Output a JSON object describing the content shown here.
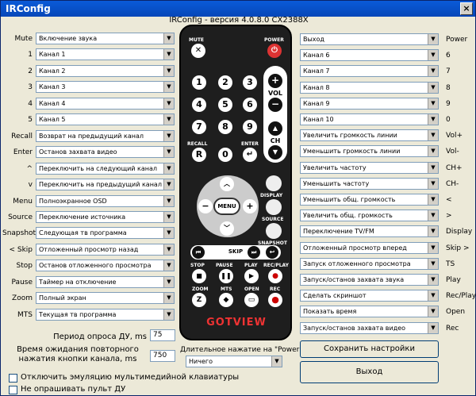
{
  "window": {
    "title": "IRConfig",
    "subtitle": "IRConfig - версия 4.0.8.0  CX2388X",
    "close": "×"
  },
  "left_rows": [
    {
      "label": "Mute",
      "value": "Включение звука"
    },
    {
      "label": "1",
      "value": "Канал 1"
    },
    {
      "label": "2",
      "value": "Канал 2"
    },
    {
      "label": "3",
      "value": "Канал 3"
    },
    {
      "label": "4",
      "value": "Канал 4"
    },
    {
      "label": "5",
      "value": "Канал 5"
    },
    {
      "label": "Recall",
      "value": "Возврат на предыдущий канал"
    },
    {
      "label": "Enter",
      "value": "Останов захвата видео"
    },
    {
      "label": "^",
      "value": "Переключить на следующий канал"
    },
    {
      "label": "v",
      "value": "Переключить на предыдущий канал"
    },
    {
      "label": "Menu",
      "value": "Полноэкранное OSD"
    },
    {
      "label": "Source",
      "value": "Переключение источника"
    },
    {
      "label": "Snapshot",
      "value": "Следующая тв программа"
    },
    {
      "label": "< Skip",
      "value": "Отложенный просмотр назад"
    },
    {
      "label": "Stop",
      "value": "Останов отложенного просмотра"
    },
    {
      "label": "Pause",
      "value": "Таймер на отключение"
    },
    {
      "label": "Zoom",
      "value": "Полный экран"
    },
    {
      "label": "MTS",
      "value": "Текущая тв программа"
    }
  ],
  "right_rows": [
    {
      "label": "Power",
      "value": "Выход"
    },
    {
      "label": "6",
      "value": "Канал 6"
    },
    {
      "label": "7",
      "value": "Канал 7"
    },
    {
      "label": "8",
      "value": "Канал 8"
    },
    {
      "label": "9",
      "value": "Канал 9"
    },
    {
      "label": "0",
      "value": "Канал 10"
    },
    {
      "label": "Vol+",
      "value": "Увеличить громкость линии"
    },
    {
      "label": "Vol-",
      "value": "Уменьшить громкость линии"
    },
    {
      "label": "CH+",
      "value": "Увеличить частоту"
    },
    {
      "label": "CH-",
      "value": "Уменьшить частоту"
    },
    {
      "label": "<",
      "value": "Уменьшить общ. громкость"
    },
    {
      "label": ">",
      "value": "Увеличить общ. громкость"
    },
    {
      "label": "Display",
      "value": "Переключение TV/FM"
    },
    {
      "label": "Skip >",
      "value": "Отложенный просмотр вперед"
    },
    {
      "label": "TS",
      "value": "Запуск отложенного просмотра"
    },
    {
      "label": "Play",
      "value": "Запуск/останов захвата звука"
    },
    {
      "label": "Rec/Play",
      "value": "Сделать скриншот"
    },
    {
      "label": "Open",
      "value": "Показать время"
    },
    {
      "label": "Rec",
      "value": "Запуск/останов захвата видео"
    }
  ],
  "remote": {
    "mute": "MUTE",
    "power": "POWER",
    "vol": "VOL",
    "ch": "CH",
    "recall": "RECALL",
    "enter": "ENTER",
    "display": "DISPLAY",
    "source": "SOURCE",
    "snapshot": "SNAPSHOT",
    "menu": "MENU",
    "skip": "SKIP",
    "stop": "STOP",
    "pause": "PAUSE",
    "play": "PLAY",
    "recplay": "REC/PLAY",
    "zoom": "ZOOM",
    "mts": "MTS",
    "open": "OPEN",
    "rec": "REC",
    "brand": "GOTVIEW",
    "r": "R",
    "digits": [
      "1",
      "2",
      "3",
      "4",
      "5",
      "6",
      "7",
      "8",
      "9",
      "0"
    ]
  },
  "bottom": {
    "period_label": "Период опроса ДУ, ms",
    "period_value": "75",
    "wait_label_1": "Время ожидания повторного",
    "wait_label_2": "нажатия кнопки канала, ms",
    "wait_value": "750",
    "long_press_label": "Длительное нажатие на \"Power\"",
    "long_press_value": "Ничего",
    "save_button": "Сохранить настройки",
    "exit_button": "Выход",
    "check1": "Отключить эмуляцию мультимедийной клавиатуры",
    "check2": "Не опрашивать пульт ДУ"
  }
}
